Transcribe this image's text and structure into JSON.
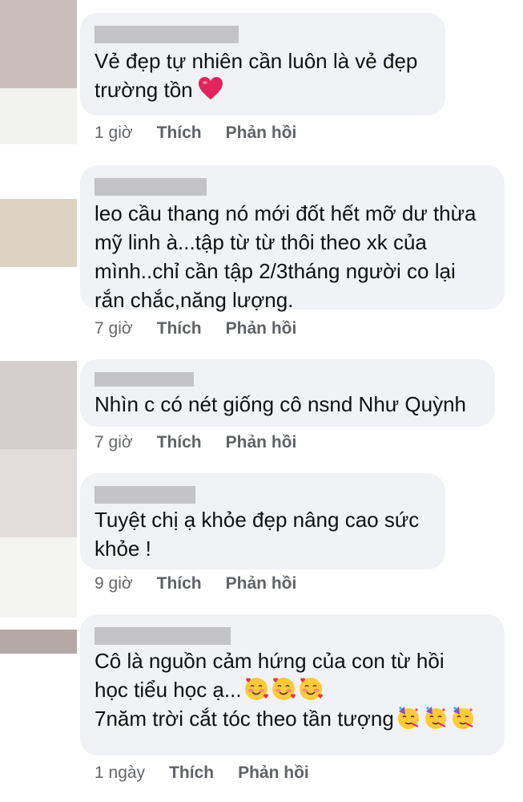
{
  "colors": {
    "bubble": "#f0f2f5",
    "meta_text": "#65676b",
    "redaction": "#c4c4c7",
    "heart": "#e0245e"
  },
  "comments": [
    {
      "lines": [
        "Vẻ đẹp tự nhiên cần luôn là vẻ đẹp",
        "trường tồn"
      ],
      "trailing_icon": "red-heart-icon",
      "time": "1 giờ",
      "like": "Thích",
      "reply": "Phản hồi"
    },
    {
      "lines": [
        "leo cầu thang nó mới đốt hết mỡ dư thừa",
        "mỹ linh à...tập từ từ thôi theo xk của",
        "mình..chỉ cần tập 2/3tháng người co lại",
        "rắn chắc,năng lượng."
      ],
      "time": "7 giờ",
      "like": "Thích",
      "reply": "Phản hồi"
    },
    {
      "lines": [
        "Nhìn c có nét giống cô nsnd Như Quỳnh"
      ],
      "time": "7 giờ",
      "like": "Thích",
      "reply": "Phản hồi"
    },
    {
      "lines": [
        "Tuyệt chị ạ khỏe đẹp nâng cao sức",
        "khỏe !"
      ],
      "time": "9 giờ",
      "like": "Thích",
      "reply": "Phản hồi"
    },
    {
      "lines": [
        "Cô là nguồn cảm hứng của con từ hồi",
        "học tiểu học ạ...",
        "7năm trời cắt tóc theo tần tượng"
      ],
      "emoji_icons": [
        "smiling-face-with-hearts-icon",
        "partying-face-icon"
      ],
      "time": "1 ngày",
      "like": "Thích",
      "reply": "Phản hồi"
    }
  ]
}
